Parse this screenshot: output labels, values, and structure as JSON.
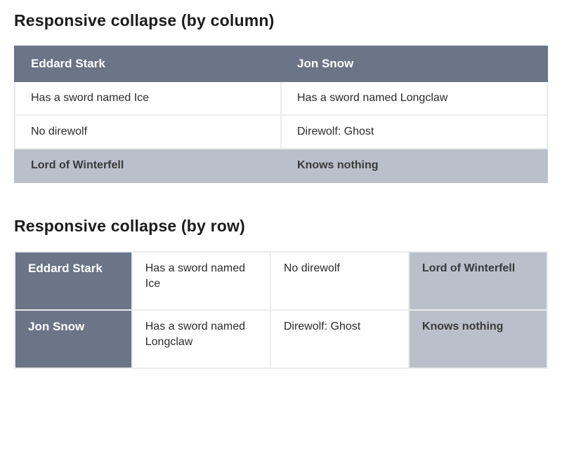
{
  "sections": {
    "byColumn": {
      "title": "Responsive collapse (by column)",
      "headers": [
        "Eddard Stark",
        "Jon Snow"
      ],
      "rows": [
        [
          "Has a sword named Ice",
          "Has a sword named Longclaw"
        ],
        [
          "No direwolf",
          "Direwolf: Ghost"
        ]
      ],
      "footer": [
        "Lord of Winterfell",
        "Knows nothing"
      ]
    },
    "byRow": {
      "title": "Responsive collapse (by row)",
      "rows": [
        {
          "header": "Eddard Stark",
          "cells": [
            "Has a sword named Ice",
            "No direwolf"
          ],
          "footer": "Lord of Winterfell"
        },
        {
          "header": "Jon Snow",
          "cells": [
            "Has a sword named Longclaw",
            "Direwolf: Ghost"
          ],
          "footer": "Knows nothing"
        }
      ]
    }
  }
}
